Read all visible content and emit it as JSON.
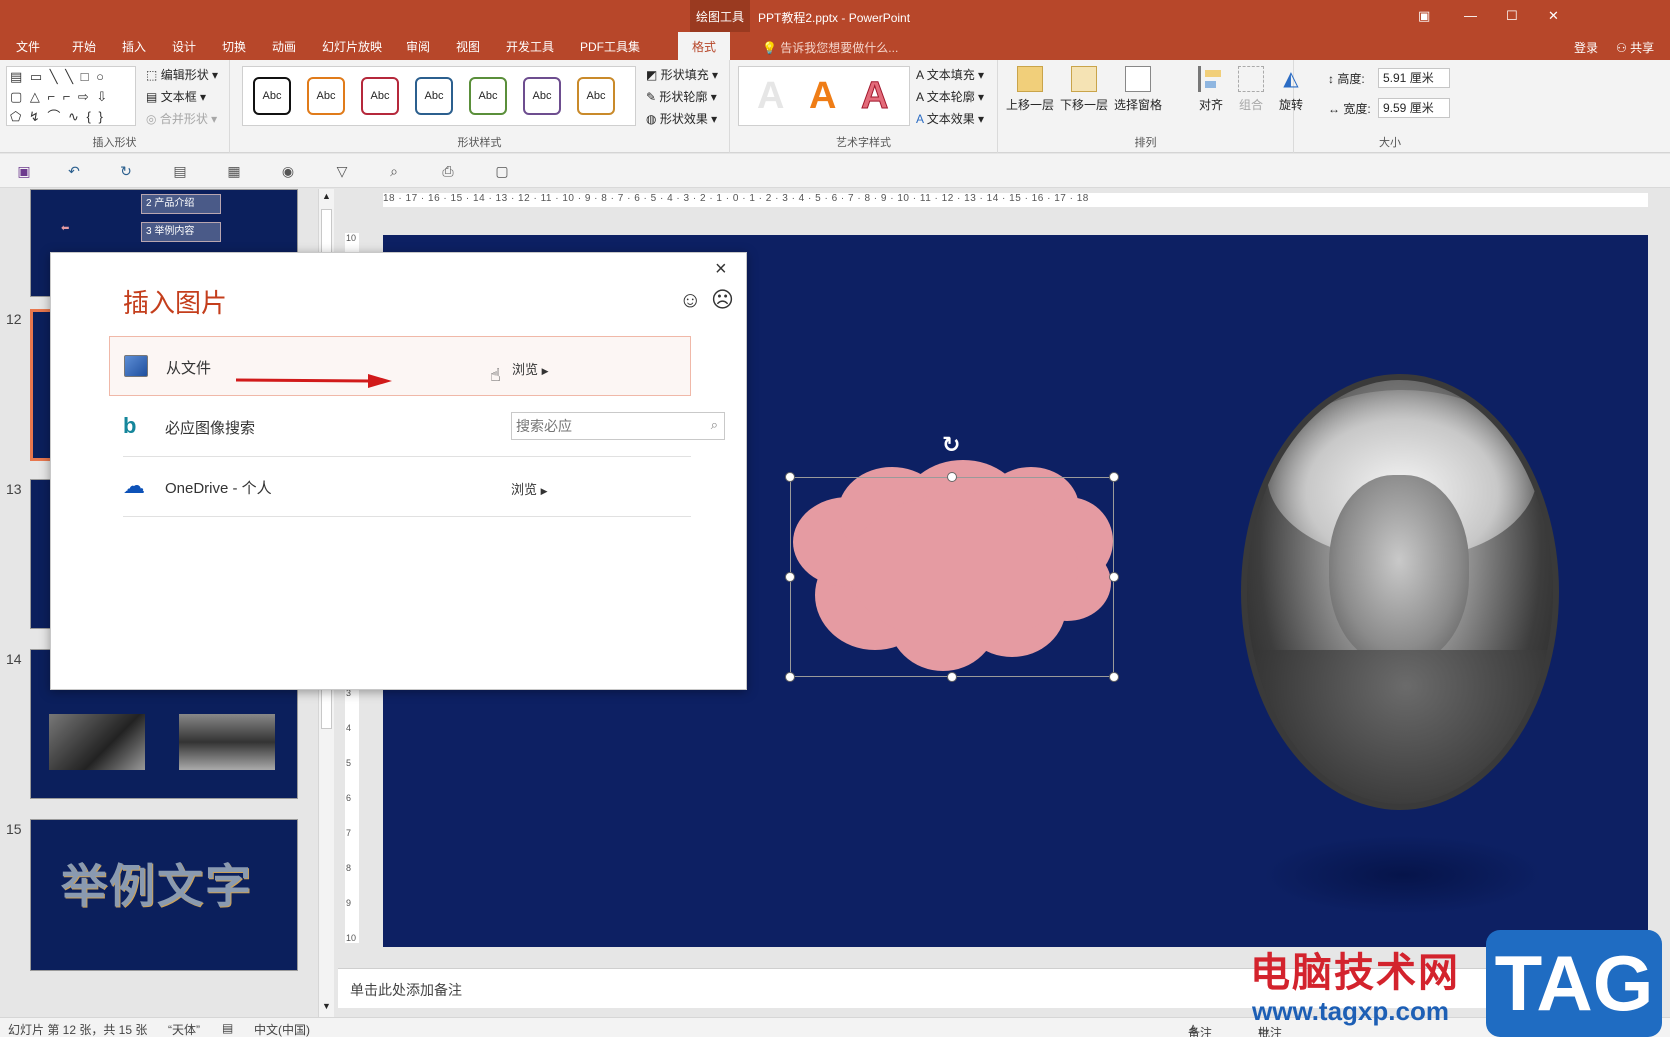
{
  "titlebar": {
    "context_tools": "绘图工具",
    "doc_title": "PPT教程2.pptx - PowerPoint"
  },
  "tabs": [
    {
      "label": "文件"
    },
    {
      "label": "开始"
    },
    {
      "label": "插入"
    },
    {
      "label": "设计"
    },
    {
      "label": "切换"
    },
    {
      "label": "动画"
    },
    {
      "label": "幻灯片放映"
    },
    {
      "label": "审阅"
    },
    {
      "label": "视图"
    },
    {
      "label": "开发工具"
    },
    {
      "label": "PDF工具集"
    },
    {
      "label": "格式"
    }
  ],
  "tell_me": "告诉我您想要做什么...",
  "login": "登录",
  "share": "共享",
  "ribbon": {
    "insert_shapes": {
      "label": "插入形状",
      "edit_shape": "编辑形状",
      "text_box": "文本框",
      "merge_shapes": "合并形状"
    },
    "shape_styles": {
      "label": "形状样式",
      "abc": "Abc",
      "fill": "形状填充",
      "outline": "形状轮廓",
      "effects": "形状效果"
    },
    "wordart": {
      "label": "艺术字样式",
      "glyph": "A",
      "text_fill": "文本填充",
      "text_outline": "文本轮廓",
      "text_effects": "文本效果"
    },
    "arrange": {
      "label": "排列",
      "bring_forward": "上移一层",
      "send_backward": "下移一层",
      "selection_pane": "选择窗格",
      "align": "对齐",
      "group": "组合",
      "rotate": "旋转"
    },
    "size": {
      "label": "大小",
      "height_label": "高度:",
      "height_value": "5.91 厘米",
      "width_label": "宽度:",
      "width_value": "9.59 厘米"
    }
  },
  "colors": {
    "brand": "#b7472a",
    "slide_bg": "#0d2063",
    "cloud": "#e59ba2",
    "dialog_title": "#c43e1c"
  },
  "thumbnails": [
    {
      "num": "",
      "text1": "2 产品介绍",
      "text2": "3 举例内容"
    },
    {
      "num": "12"
    },
    {
      "num": "13"
    },
    {
      "num": "14"
    },
    {
      "num": "15",
      "title": "举例文字"
    }
  ],
  "hruler": "18 · 17 · 16 · 15 · 14 · 13 · 12 · 11 · 10 · 9 · 8 · 7 · 6 · 5 · 4 · 3 · 2 · 1 · 0 · 1 · 2 · 3 · 4 · 5 · 6 · 7 · 8 · 9 · 10 · 11 · 12 · 13 · 14 · 15 · 16 · 17 · 18",
  "vruler": [
    "10",
    "9",
    "8",
    "7",
    "6",
    "5",
    "4",
    "3",
    "2",
    "1",
    "0",
    "1",
    "2",
    "3",
    "4",
    "5",
    "6",
    "7",
    "8",
    "9",
    "10"
  ],
  "dialog": {
    "title": "插入图片",
    "close": "×",
    "smile": "☺",
    "frown": "☹",
    "rows": [
      {
        "label": "从文件",
        "browse": "浏览"
      },
      {
        "label": "必应图像搜索",
        "search_placeholder": "搜索必应"
      },
      {
        "label": "OneDrive - 个人",
        "browse": "浏览"
      }
    ]
  },
  "notes_placeholder": "单击此处添加备注",
  "status": {
    "slide_info": "幻灯片 第 12 张，共 15 张",
    "theme": "“天体”",
    "language": "中文(中国)",
    "notes_btn": "备注",
    "comments_btn": "批注"
  },
  "watermark": {
    "site_cn": "电脑技术网",
    "site_url": "www.tagxp.com",
    "tag": "TAG"
  }
}
